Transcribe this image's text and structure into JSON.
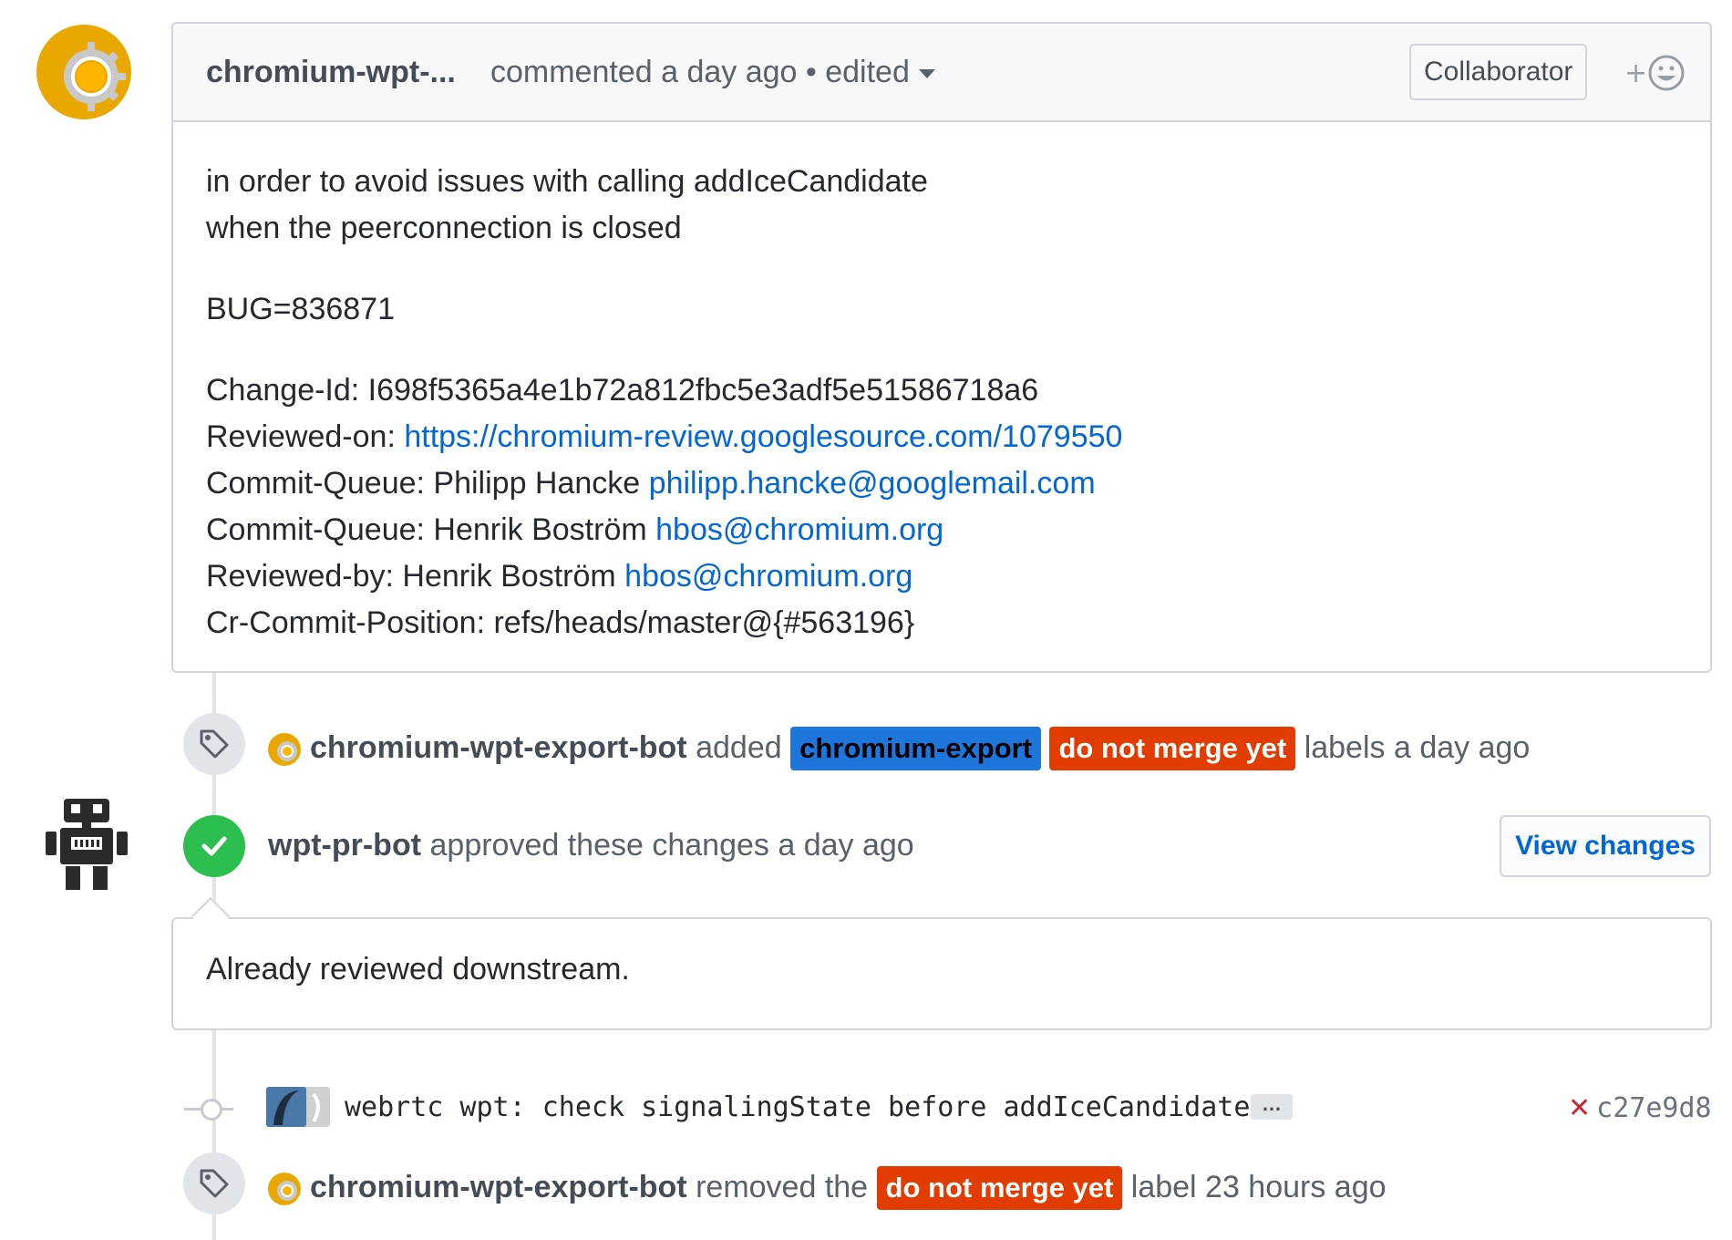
{
  "comment": {
    "author": "chromium-wpt-...",
    "meta": "commented a day ago • edited",
    "badge": "Collaborator",
    "react": "+☺",
    "body": {
      "line1": "in order to avoid issues with calling addIceCandidate",
      "line2": "when the peerconnection is closed",
      "bug": "BUG=836871",
      "change_id": "Change-Id: I698f5365a4e1b72a812fbc5e3adf5e51586718a6",
      "reviewed_on_label": "Reviewed-on: ",
      "reviewed_on_link": "https://chromium-review.googlesource.com/1079550",
      "cq1_label": "Commit-Queue: Philipp Hancke ",
      "cq1_email": "philipp.hancke@googlemail.com",
      "cq2_label": "Commit-Queue: Henrik Boström ",
      "cq2_email": "hbos@chromium.org",
      "rb_label": "Reviewed-by: Henrik Boström ",
      "rb_email": "hbos@chromium.org",
      "position": "Cr-Commit-Position: refs/heads/master@{#563196}"
    }
  },
  "event_labels_added": {
    "actor": "chromium-wpt-export-bot",
    "verb": "added",
    "label1": "chromium-export",
    "label2": "do not merge yet",
    "suffix": "labels a day ago"
  },
  "review": {
    "actor": "wpt-pr-bot",
    "text": "approved these changes a day ago",
    "button": "View changes",
    "body": "Already reviewed downstream."
  },
  "commit": {
    "message": "webrtc wpt: check signalingState before addIceCandidate",
    "ellipsis": "…",
    "status": "✕",
    "sha": "c27e9d8"
  },
  "event_label_removed": {
    "actor": "chromium-wpt-export-bot",
    "verb": "removed the",
    "label": "do not merge yet",
    "suffix": "label 23 hours ago"
  },
  "colors": {
    "label_blue": "#1d76db",
    "label_red": "#e23c00",
    "link": "#0366d6",
    "approve_green": "#2cbe4e"
  }
}
